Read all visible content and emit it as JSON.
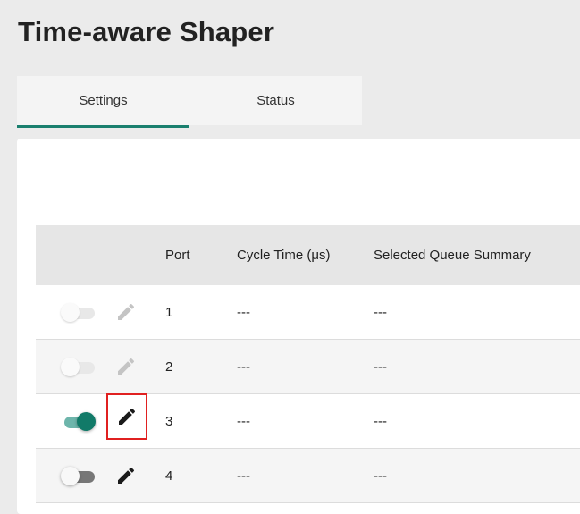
{
  "page": {
    "title": "Time-aware Shaper"
  },
  "tabs": [
    {
      "label": "Settings",
      "active": true
    },
    {
      "label": "Status",
      "active": false
    }
  ],
  "table": {
    "headers": [
      "Port",
      "Cycle Time (μs)",
      "Selected Queue Summary"
    ],
    "rows": [
      {
        "toggle": "disabled",
        "edit_icon": "pencil-icon",
        "port": "1",
        "cycle_time": "---",
        "queue_summary": "---"
      },
      {
        "toggle": "disabled",
        "edit_icon": "pencil-icon",
        "port": "2",
        "cycle_time": "---",
        "queue_summary": "---"
      },
      {
        "toggle": "on",
        "edit_icon": "pencil-icon",
        "port": "3",
        "cycle_time": "---",
        "queue_summary": "---"
      },
      {
        "toggle": "off",
        "edit_icon": "pencil-icon",
        "port": "4",
        "cycle_time": "---",
        "queue_summary": "---"
      }
    ]
  },
  "colors": {
    "accent": "#117a68",
    "accent_light": "#6db5ab",
    "highlight_box": "#e02020"
  }
}
